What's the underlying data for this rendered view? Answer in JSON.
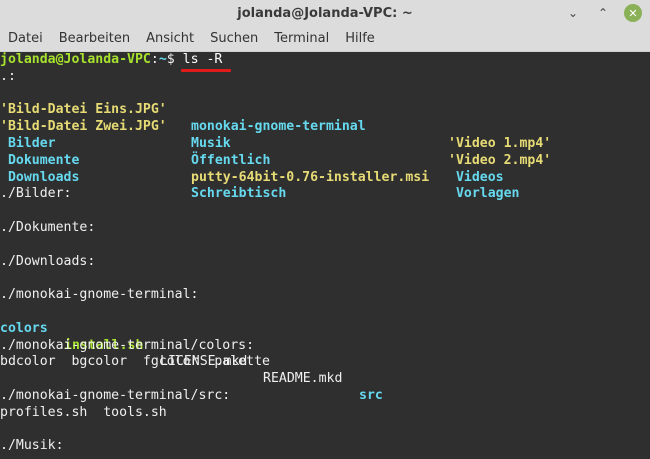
{
  "window": {
    "title": "jolanda@Jolanda-VPC: ~",
    "controls": {
      "minimize": "⌄",
      "maximize": "⌃",
      "close": "✕"
    }
  },
  "menu": [
    "Datei",
    "Bearbeiten",
    "Ansicht",
    "Suchen",
    "Terminal",
    "Hilfe"
  ],
  "terminal": {
    "prompt": {
      "user": "jolanda@Jolanda-VPC",
      "sep": ":",
      "path": "~",
      "sym": "$ ",
      "command": "ls -R"
    },
    "root_header": ".:",
    "listing": [
      [
        "'Bild-Datei Eins.JPG'",
        "monokai-gnome-terminal",
        "'Video 1.mp4'"
      ],
      [
        "'Bild-Datei Zwei.JPG'",
        "Musik",
        "'Video 2.mp4'"
      ],
      [
        " Bilder",
        "Öffentlich",
        " Videos"
      ],
      [
        " Dokumente",
        "putty-64bit-0.76-installer.msi",
        " Vorlagen"
      ],
      [
        " Downloads",
        "Schreibtisch",
        ""
      ]
    ],
    "sections": {
      "bilder": "./Bilder:",
      "dokumente": "./Dokumente:",
      "downloads": "./Downloads:",
      "monokai": "./monokai-gnome-terminal:",
      "monokai_files": [
        "colors",
        "install.sh",
        "LICENSE.mkd",
        "README.mkd",
        "src"
      ],
      "colors_dir": "./monokai-gnome-terminal/colors:",
      "colors_files": "bdcolor  bgcolor  fgcolor  palette",
      "src_dir": "./monokai-gnome-terminal/src:",
      "src_files": "profiles.sh  tools.sh",
      "musik": "./Musik:"
    },
    "colors": {
      "background": "#2f2f2f",
      "green": "#a6e22e",
      "blue": "#66d9ef",
      "yellow": "#e6db74",
      "underline": "#e01b1b"
    }
  }
}
